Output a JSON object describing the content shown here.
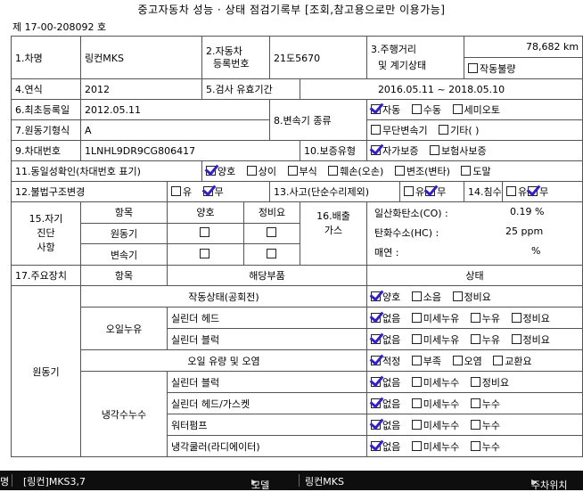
{
  "title": "중고자동차 성능 · 상태 점검기록부 [조회,참고용으로만 이용가능]",
  "doc_no": "제 17-00-208092 호",
  "r1": {
    "car_name_label": "1.차명",
    "car_name": "링컨MKS",
    "reg_label_1": "2.자동차",
    "reg_label_2": "등록번호",
    "reg_no": "21도5670",
    "mileage_label_1": "3.주행거리",
    "mileage_label_2": "및 계기상태",
    "mileage": "78,682 km",
    "meter_fail": "작동불량"
  },
  "r2": {
    "year_label": "4.연식",
    "year": "2012",
    "valid_label": "5.검사 유효기간",
    "valid": "2016.05.11 ~ 2018.05.10"
  },
  "r3": {
    "first_reg_label": "6.최초등록일",
    "first_reg": "2012.05.11",
    "trans_label": "8.변속기 종류",
    "trans_opt1": [
      "자동",
      "수동",
      "세미오토"
    ],
    "trans_opt2": [
      "무단변속기",
      "기타(   )"
    ]
  },
  "r4": {
    "engine_label": "7.원동기형식",
    "engine": "A"
  },
  "r5": {
    "vin_label": "9.차대번호",
    "vin": "1LNHL9DR9CG806417",
    "warranty_label": "10.보증유형",
    "warranty_opts": [
      "자가보증",
      "보험사보증"
    ]
  },
  "r6": {
    "identity_label": "11.동일성확인(차대번호 표기)",
    "identity_opts": [
      "양호",
      "상이",
      "부식",
      "훼손(오손)",
      "변조(변타)",
      "도말"
    ]
  },
  "r7": {
    "illegal_label": "12.불법구조변경",
    "yes": "유",
    "no": "무",
    "accident_label": "13.사고(단순수리제외)",
    "flood_label": "14.침수유무"
  },
  "self": {
    "label_1": "15.자기",
    "label_2": "진단",
    "label_3": "사항",
    "col_item": "항목",
    "col_good": "양호",
    "col_repair": "정비요",
    "rows": [
      "원동기",
      "변속기"
    ]
  },
  "emission": {
    "label_1": "16.배출",
    "label_2": "가스",
    "co_label": "일산화탄소(CO) :",
    "co": "0.19 %",
    "hc_label": "탄화수소(HC) :",
    "hc": "25 ppm",
    "smoke_label": "매연 :",
    "smoke": "%"
  },
  "main": {
    "label": "17.주요장치",
    "col_item": "항목",
    "col_part": "해당부품",
    "col_state": "상태",
    "group_engine": "원동기",
    "sub_oil": "오일누유",
    "sub_coolant": "냉각수누수",
    "rows": [
      {
        "part": "작동상태(공회전)",
        "opts": [
          "양호",
          "소음",
          "정비요"
        ]
      },
      {
        "part": "실린더 헤드",
        "opts": [
          "없음",
          "미세누유",
          "누유",
          "정비요"
        ]
      },
      {
        "part": "실린더 블럭",
        "opts": [
          "없음",
          "미세누유",
          "누유",
          "정비요"
        ]
      },
      {
        "part": "오일 유량 및 오염",
        "opts": [
          "적정",
          "부족",
          "오염",
          "교환요"
        ]
      },
      {
        "part": "실린더 블럭",
        "opts": [
          "없음",
          "미세누수",
          "정비요"
        ]
      },
      {
        "part": "실린더 헤드/가스켓",
        "opts": [
          "없음",
          "미세누수",
          "누수"
        ]
      },
      {
        "part": "워터펌프",
        "opts": [
          "없음",
          "미세누수",
          "누수"
        ]
      },
      {
        "part": "냉각쿨러(라디에이터)",
        "opts": [
          "없음",
          "미세누수",
          "누수"
        ]
      }
    ]
  },
  "bottom": {
    "left_cut": "명",
    "model_name": "[링컨]MKS3,7",
    "model_label": "모델",
    "model_value": "링컨MKS",
    "right_label": "주차위치"
  },
  "colors": {
    "check": "#3320c8",
    "bar": "#0e0e0e"
  }
}
